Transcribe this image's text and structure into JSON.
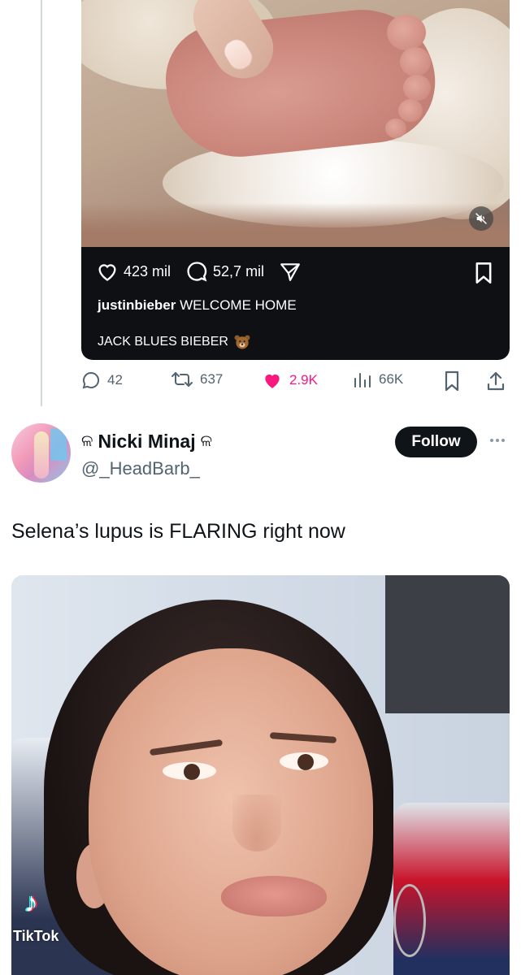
{
  "tweet1": {
    "media": {
      "stats": {
        "likes": "423 mil",
        "comments": "52,7 mil"
      },
      "caption_user": "justinbieber",
      "caption_text": "WELCOME HOME",
      "caption_line2": "JACK BLUES BIEBER",
      "emoji_icon": "bear-face-icon"
    },
    "actions": {
      "replies": "42",
      "reposts": "637",
      "likes": "2.9K",
      "views": "66K"
    }
  },
  "tweet2": {
    "display_name": "Nicki Minaj",
    "name_deco": "ଳ",
    "handle": "@_HeadBarb_",
    "follow_label": "Follow",
    "text": "Selena’s lupus is FLARING right now",
    "media": {
      "watermark": "TikTok"
    }
  },
  "colors": {
    "like_active": "#f91880",
    "muted_text": "#536471",
    "follow_bg": "#0f1419"
  }
}
